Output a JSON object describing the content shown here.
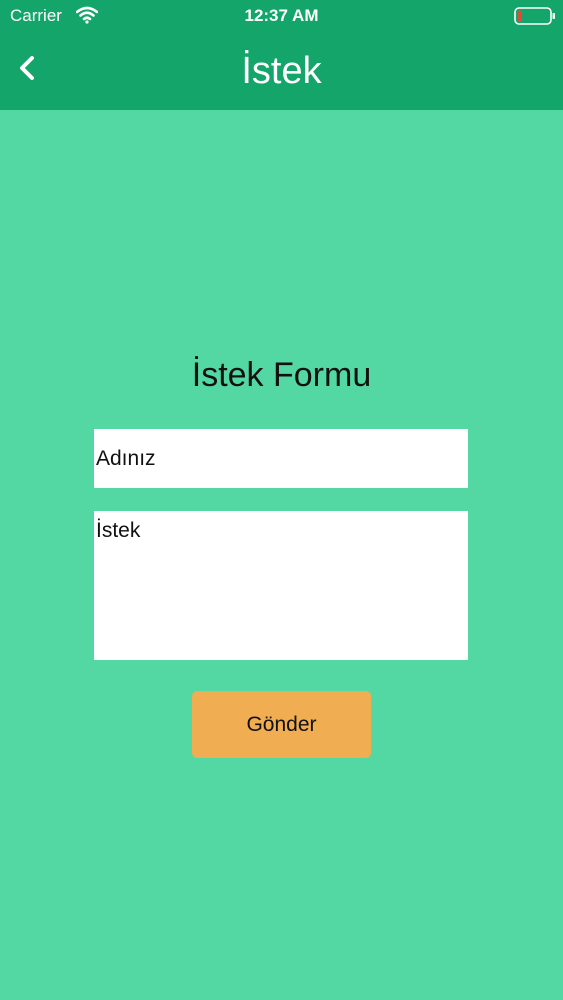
{
  "status_bar": {
    "carrier": "Carrier",
    "time": "12:37 AM",
    "wifi_icon": "wifi-icon",
    "battery_icon": "battery-low-icon"
  },
  "nav": {
    "title": "İstek",
    "back_icon": "chevron-left-icon"
  },
  "form": {
    "title": "İstek Formu",
    "name_placeholder": "Adınız",
    "request_placeholder": "İstek",
    "submit_label": "Gönder"
  },
  "colors": {
    "header": "#13a56a",
    "background": "#53d8a3",
    "button": "#f0ad52",
    "battery_level": "#e04a3a"
  }
}
